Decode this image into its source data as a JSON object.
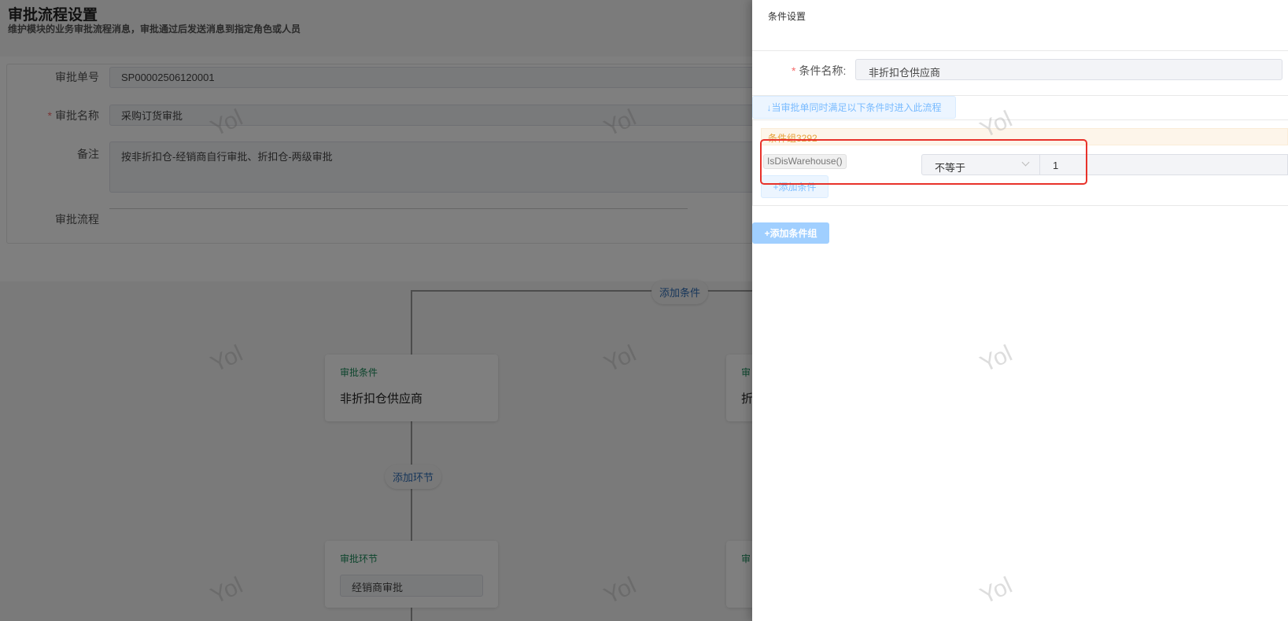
{
  "page": {
    "title": "审批流程设置",
    "subtitle": "维护模块的业务审批流程消息，审批通过后发送消息到指定角色或人员"
  },
  "form": {
    "approval_no": {
      "label": "审批单号",
      "value": "SP00002506120001"
    },
    "approval_name": {
      "label": "审批名称",
      "value": "采购订货审批",
      "required": "*"
    },
    "remark": {
      "label": "备注",
      "value": "按非折扣仓-经销商自行审批、折扣仓-两级审批"
    },
    "flow": {
      "label": "审批流程"
    }
  },
  "flow": {
    "add_condition": "添加条件",
    "add_step": "添加环节",
    "cards": [
      {
        "kind": "审批条件",
        "value": "非折扣仓供应商"
      },
      {
        "kind": "审",
        "value": "折"
      },
      {
        "kind": "审批环节",
        "value": "经销商审批"
      },
      {
        "kind": "审"
      }
    ]
  },
  "watermark": "Yol",
  "drawer": {
    "title": "条件设置",
    "name_label": "条件名称:",
    "required": "*",
    "name_value": "非折扣仓供应商",
    "notice": "↓当审批单同时满足以下条件时进入此流程",
    "group_title": "条件组3292",
    "condition": {
      "field": "IsDisWarehouse()",
      "operator": "不等于",
      "value": "1"
    },
    "add_condition": "+添加条件",
    "add_group": "+添加条件组",
    "highlight_color": "#e8322a"
  }
}
